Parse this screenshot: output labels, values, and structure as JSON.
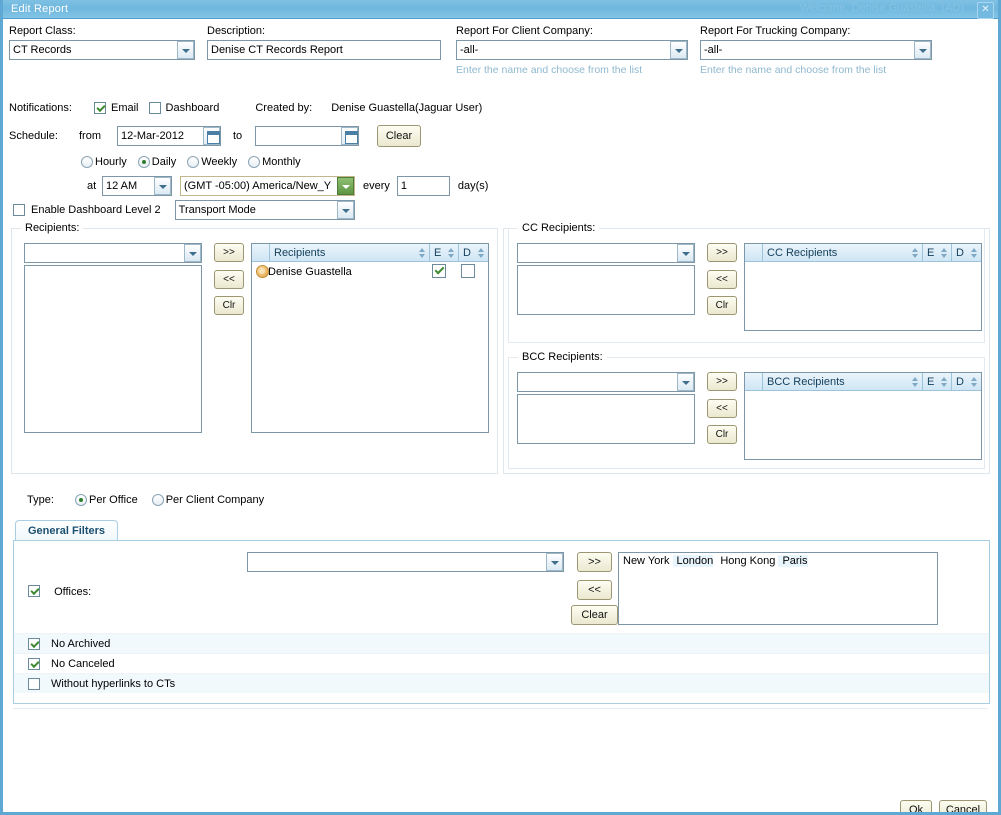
{
  "window": {
    "title": "Edit Report",
    "ghost_text": "Welcome, Denise Guastella, (AD)",
    "close_label": "✕"
  },
  "header": {
    "report_class": {
      "label": "Report Class:",
      "value": "CT Records"
    },
    "description": {
      "label": "Description:",
      "value": "Denise CT Records Report"
    },
    "client_company": {
      "label": "Report For Client Company:",
      "value": "-all-",
      "hint": "Enter the name and choose from the list"
    },
    "trucking_company": {
      "label": "Report For Trucking Company:",
      "value": "-all-",
      "hint": "Enter the name and choose from the list"
    }
  },
  "notifications": {
    "label": "Notifications:",
    "email_label": "Email",
    "email_checked": true,
    "dashboard_label": "Dashboard",
    "dashboard_checked": false,
    "created_by_label": "Created by:",
    "created_by_value": "Denise Guastella(Jaguar User)"
  },
  "schedule": {
    "label": "Schedule:",
    "from_label": "from",
    "from_value": "12-Mar-2012",
    "to_label": "to",
    "to_value": "",
    "clear_label": "Clear",
    "frequency": [
      {
        "label": "Hourly",
        "selected": false
      },
      {
        "label": "Daily",
        "selected": true
      },
      {
        "label": "Weekly",
        "selected": false
      },
      {
        "label": "Monthly",
        "selected": false
      }
    ],
    "at_label": "at",
    "time_value": "12 AM",
    "timezone_value": "(GMT -05:00) America/New_Y",
    "every_label": "every",
    "every_value": "1",
    "days_label": "day(s)"
  },
  "dashboard_level2": {
    "label": "Enable Dashboard Level 2",
    "checked": false,
    "mode_value": "Transport Mode"
  },
  "recipients": {
    "legend": "Recipients:",
    "picker_value": "",
    "add_label": ">>",
    "remove_label": "<<",
    "clear_label": "Clr",
    "columns": [
      "Recipients",
      "E",
      "D"
    ],
    "rows": [
      {
        "name": "Denise Guastella",
        "e": true,
        "d": false
      }
    ]
  },
  "cc_recipients": {
    "legend": "CC Recipients:",
    "picker_value": "",
    "add_label": ">>",
    "remove_label": "<<",
    "clear_label": "Clr",
    "columns": [
      "CC Recipients",
      "E",
      "D"
    ],
    "rows": []
  },
  "bcc_recipients": {
    "legend": "BCC Recipients:",
    "picker_value": "",
    "add_label": ">>",
    "remove_label": "<<",
    "clear_label": "Clr",
    "columns": [
      "BCC Recipients",
      "E",
      "D"
    ],
    "rows": []
  },
  "type": {
    "label": "Type:",
    "options": [
      {
        "label": "Per Office",
        "selected": true
      },
      {
        "label": "Per Client Company",
        "selected": false
      }
    ]
  },
  "tabs": [
    {
      "label": "General Filters",
      "active": true
    }
  ],
  "filters": {
    "offices": {
      "label": "Offices:",
      "checked": true,
      "picker_value": "",
      "add_label": ">>",
      "remove_label": "<<",
      "clear_label": "Clear",
      "selected": [
        "New York",
        "London",
        "Hong Kong",
        "Paris"
      ]
    },
    "checkboxes": [
      {
        "label": "No Archived",
        "checked": true
      },
      {
        "label": "No Canceled",
        "checked": true
      },
      {
        "label": "Without hyperlinks to CTs",
        "checked": false
      }
    ]
  },
  "footer": {
    "ok_label": "Ok",
    "cancel_label": "Cancel"
  },
  "colors": {
    "titlebar": "#6fb7de",
    "window_border": "#5fa8d3",
    "hint_text": "#8fb8cf",
    "grid_header": "#cfe6f5",
    "check_green": "#3f8a32",
    "button_face": "#ebe8cf"
  }
}
